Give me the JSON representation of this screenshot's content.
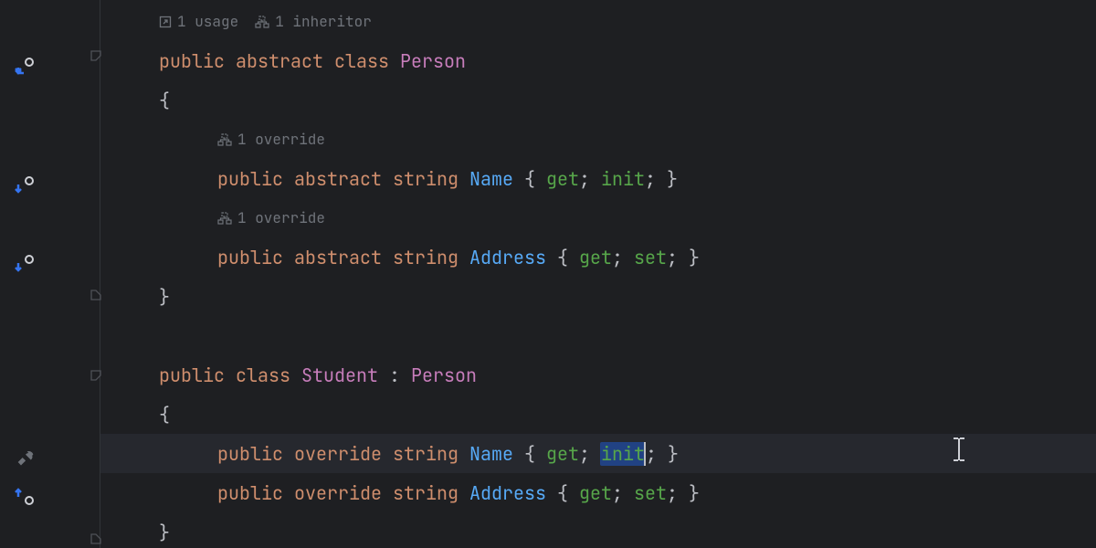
{
  "hints": {
    "usage_icon": "↗",
    "usage_label": "1 usage",
    "inheritor_label": "1 inheritor",
    "override_label": "1 override"
  },
  "code": {
    "public": "public",
    "abstract": "abstract",
    "class": "class",
    "override": "override",
    "string": "string",
    "get": "get",
    "set": "set",
    "init": "init",
    "Person": "Person",
    "Student": "Student",
    "Name": "Name",
    "Address": "Address",
    "colon": " : ",
    "open_brace": "{",
    "close_brace": "}",
    "semi": ";",
    "space": " "
  }
}
